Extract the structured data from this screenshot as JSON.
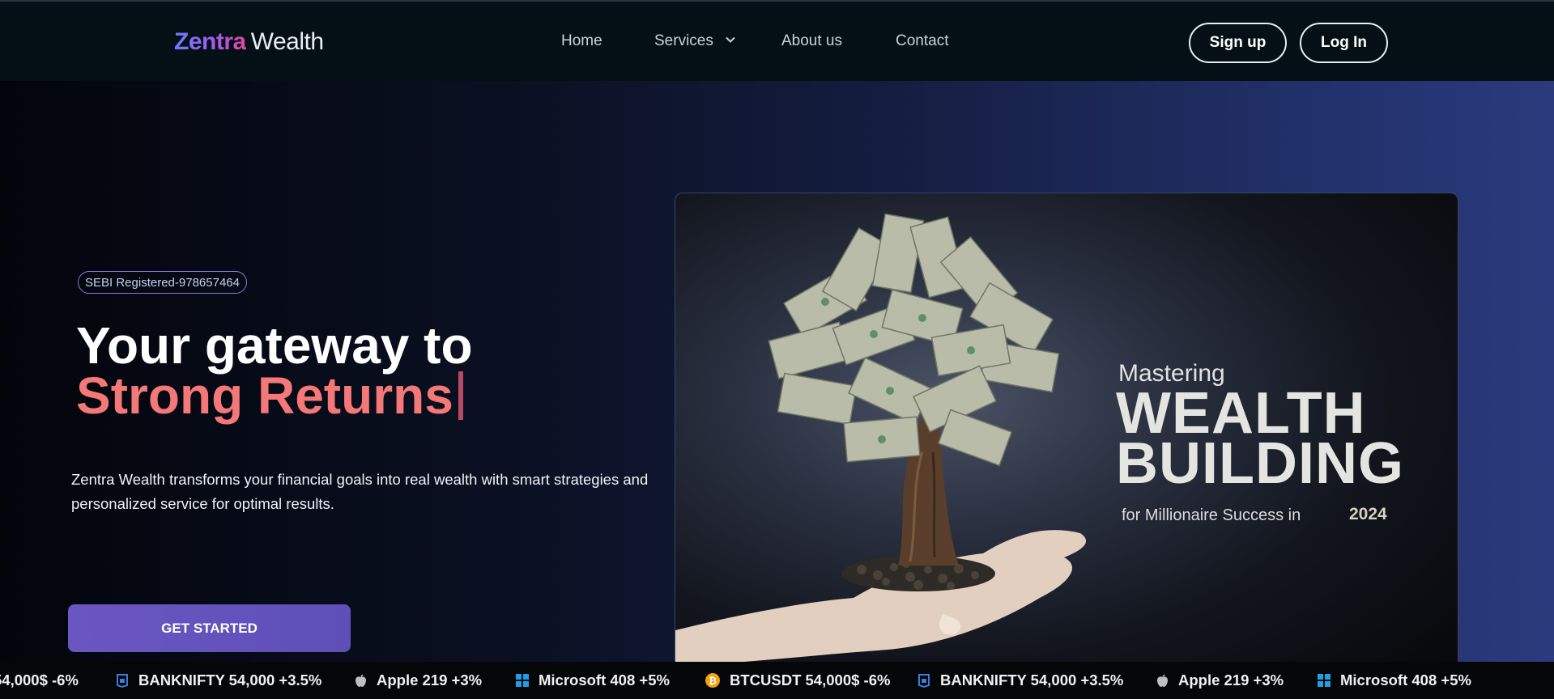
{
  "brand": {
    "name_part1": "Zentra",
    "name_part2": "Wealth"
  },
  "nav": {
    "home": "Home",
    "services": "Services",
    "about": "About us",
    "contact": "Contact",
    "signup": "Sign up",
    "login": "Log In"
  },
  "hero": {
    "badge": "SEBI Registered-978657464",
    "headline_line1": "Your gateway to",
    "headline_line2": "Strong Returns",
    "description": "Zentra Wealth transforms your financial goals into real wealth with smart strategies and personalized service for optimal results.",
    "cta": "GET STARTED"
  },
  "hero_image": {
    "mastering": "Mastering",
    "wealth": "WEALTH",
    "building": "BUILDING",
    "subtitle": "for Millionaire Success in",
    "year": "2024"
  },
  "ticker": {
    "items": [
      {
        "icon": "bitcoin-icon",
        "text": "54,000$ -6%"
      },
      {
        "icon": "bank-icon",
        "text": "BANKNIFTY 54,000 +3.5%"
      },
      {
        "icon": "apple-icon",
        "text": "Apple 219 +3%"
      },
      {
        "icon": "windows-icon",
        "text": "Microsoft 408 +5%"
      },
      {
        "icon": "bitcoin-icon",
        "text": "BTCUSDT 54,000$ -6%"
      },
      {
        "icon": "bank-icon",
        "text": "BANKNIFTY 54,000 +3.5%"
      },
      {
        "icon": "apple-icon",
        "text": "Apple 219 +3%"
      },
      {
        "icon": "windows-icon",
        "text": "Microsoft 408 +5%"
      }
    ]
  },
  "colors": {
    "accent_purple": "#6a56c2",
    "headline_highlight": "#f57878",
    "badge_border": "#8c78e8"
  }
}
